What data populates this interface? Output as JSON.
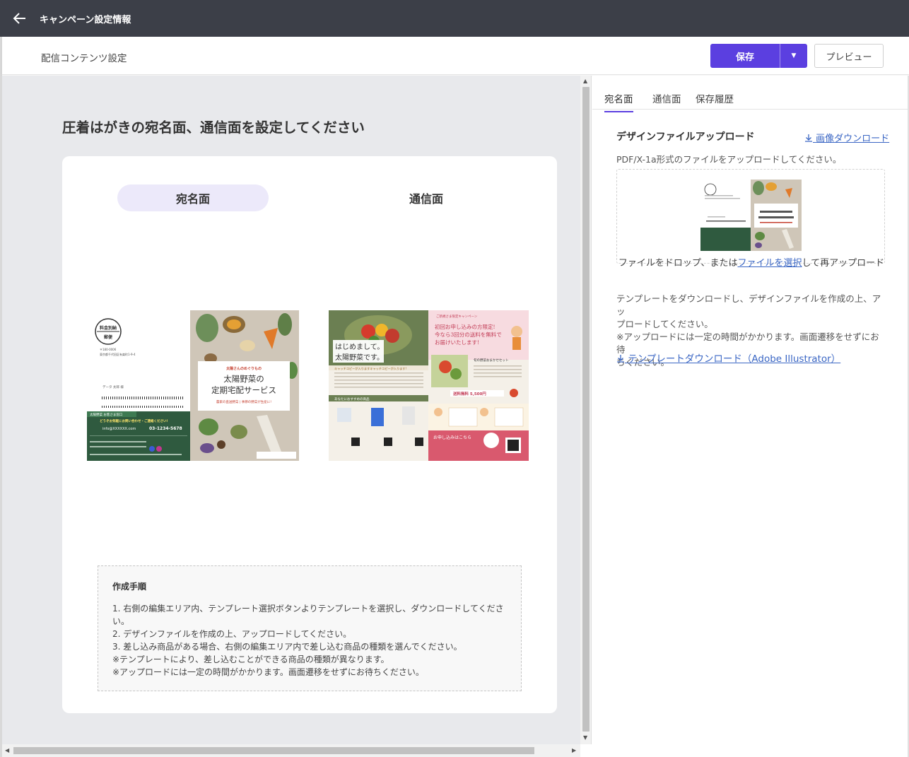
{
  "header": {
    "title": "キャンペーン設定情報"
  },
  "subheader": {
    "title": "配信コンテンツ設定",
    "save_label": "保存",
    "preview_label": "プレビュー"
  },
  "main": {
    "heading": "圧着はがきの宛名面、通信面を設定してください",
    "side_tabs": [
      "宛名面",
      "通信面"
    ],
    "active_side_tab": "宛名面",
    "address_preview": {
      "badge_line1": "料金別納",
      "badge_line2": "郵便",
      "postal": "〒180-0006",
      "address": "東京都千代田区有楽町1-9-4",
      "recipient": "データ 太郎 様",
      "contact_title": "太陽野菜 お客さま窓口",
      "contact_cta": "どうぞお気軽にお問い合わせ・ご連絡ください!",
      "email": "info@XXXXXX.com",
      "phone": "03-1234-5678",
      "card_title_small": "太陽さんのめぐりもの",
      "card_title_line1": "太陽野菜の",
      "card_title_line2": "定期宅配サービス",
      "card_subtitle": "農家の直送野菜 | 季節の野菜が生産に!"
    },
    "message_preview": {
      "campaign_label": "ご新規さま限定キャンペーン",
      "campaign_line1": "初回お申し込みの方限定!",
      "campaign_line2": "今なら3回分の送料を無料で",
      "campaign_line3": "お届けいたします!",
      "greeting_line1": "はじめまして。",
      "greeting_line2": "太陽野菜です。",
      "catch_copy": "キャッチコピーが入りますキャッチコピーが入ります!",
      "recommend": "あなたにおすすめの商品",
      "set_title": "旬の野菜おまかせセット",
      "price_label": "送料無料 5,500円",
      "apply_label": "お申し込みはこちら"
    },
    "howto": {
      "title": "作成手順",
      "lines": [
        "1. 右側の編集エリア内、テンプレート選択ボタンよりテンプレートを選択し、ダウンロードしてくださ",
        "い。",
        "2. デザインファイルを作成の上、アップロードしてください。",
        "3. 差し込み商品がある場合、右側の編集エリア内で差し込む商品の種類を選んでください。",
        "※テンプレートにより、差し込むことができる商品の種類が異なります。",
        "※アップロードには一定の時間がかかります。画面遷移をせずにお待ちください。"
      ]
    }
  },
  "right": {
    "tabs": [
      "宛名面",
      "通信面",
      "保存履歴"
    ],
    "active_tab": "宛名面",
    "upload_title": "デザインファイルアップロード",
    "image_download": "画像ダウンロード",
    "upload_desc": "PDF/X-1a形式のファイルをアップロードしてください。",
    "drop_prefix": "ファイルをドロップ、または",
    "drop_link": "ファイルを選択",
    "drop_suffix": "して再アップロード",
    "help_lines": [
      "テンプレートをダウンロードし、デザインファイルを作成の上、アッ",
      "プロードしてください。",
      "※アップロードには一定の時間がかかります。画面遷移をせずにお待",
      "ちください。"
    ],
    "template_download": "テンプレートダウンロード（Adobe Illustrator）"
  },
  "colors": {
    "topbar": "#3c3f48",
    "accent": "#5b3fe0",
    "link": "#3a66c4",
    "green": "#2e5e3e",
    "pink": "#d9596e"
  },
  "icons": [
    "back-arrow-icon",
    "chevron-down-icon",
    "download-icon",
    "vertical-scrollbar",
    "horizontal-scrollbar"
  ]
}
